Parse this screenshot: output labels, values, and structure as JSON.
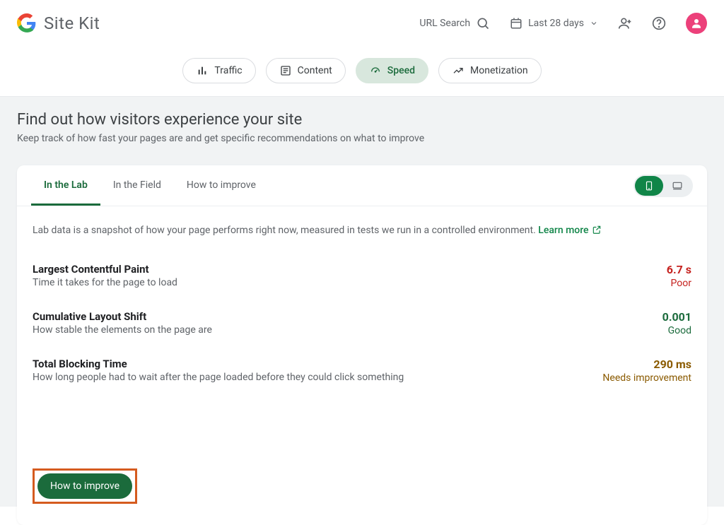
{
  "header": {
    "title": "Site Kit",
    "url_search": "URL Search",
    "date_range": "Last 28 days"
  },
  "nav": {
    "traffic": "Traffic",
    "content": "Content",
    "speed": "Speed",
    "monetization": "Monetization"
  },
  "page": {
    "title": "Find out how visitors experience your site",
    "subtitle": "Keep track of how fast your pages are and get specific recommendations on what to improve"
  },
  "card": {
    "tabs": {
      "lab": "In the Lab",
      "field": "In the Field",
      "improve": "How to improve"
    },
    "lab_desc_prefix": "Lab data is a snapshot of how your page performs right now, measured in tests we run in a controlled environment. ",
    "learn_more": "Learn more",
    "metrics": [
      {
        "title": "Largest Contentful Paint",
        "sub": "Time it takes for the page to load",
        "value": "6.7 s",
        "rating": "Poor",
        "cls": "poor"
      },
      {
        "title": "Cumulative Layout Shift",
        "sub": "How stable the elements on the page are",
        "value": "0.001",
        "rating": "Good",
        "cls": "good"
      },
      {
        "title": "Total Blocking Time",
        "sub": "How long people had to wait after the page loaded before they could click something",
        "value": "290 ms",
        "rating": "Needs improvement",
        "cls": "needs"
      }
    ],
    "how_btn": "How to improve"
  }
}
